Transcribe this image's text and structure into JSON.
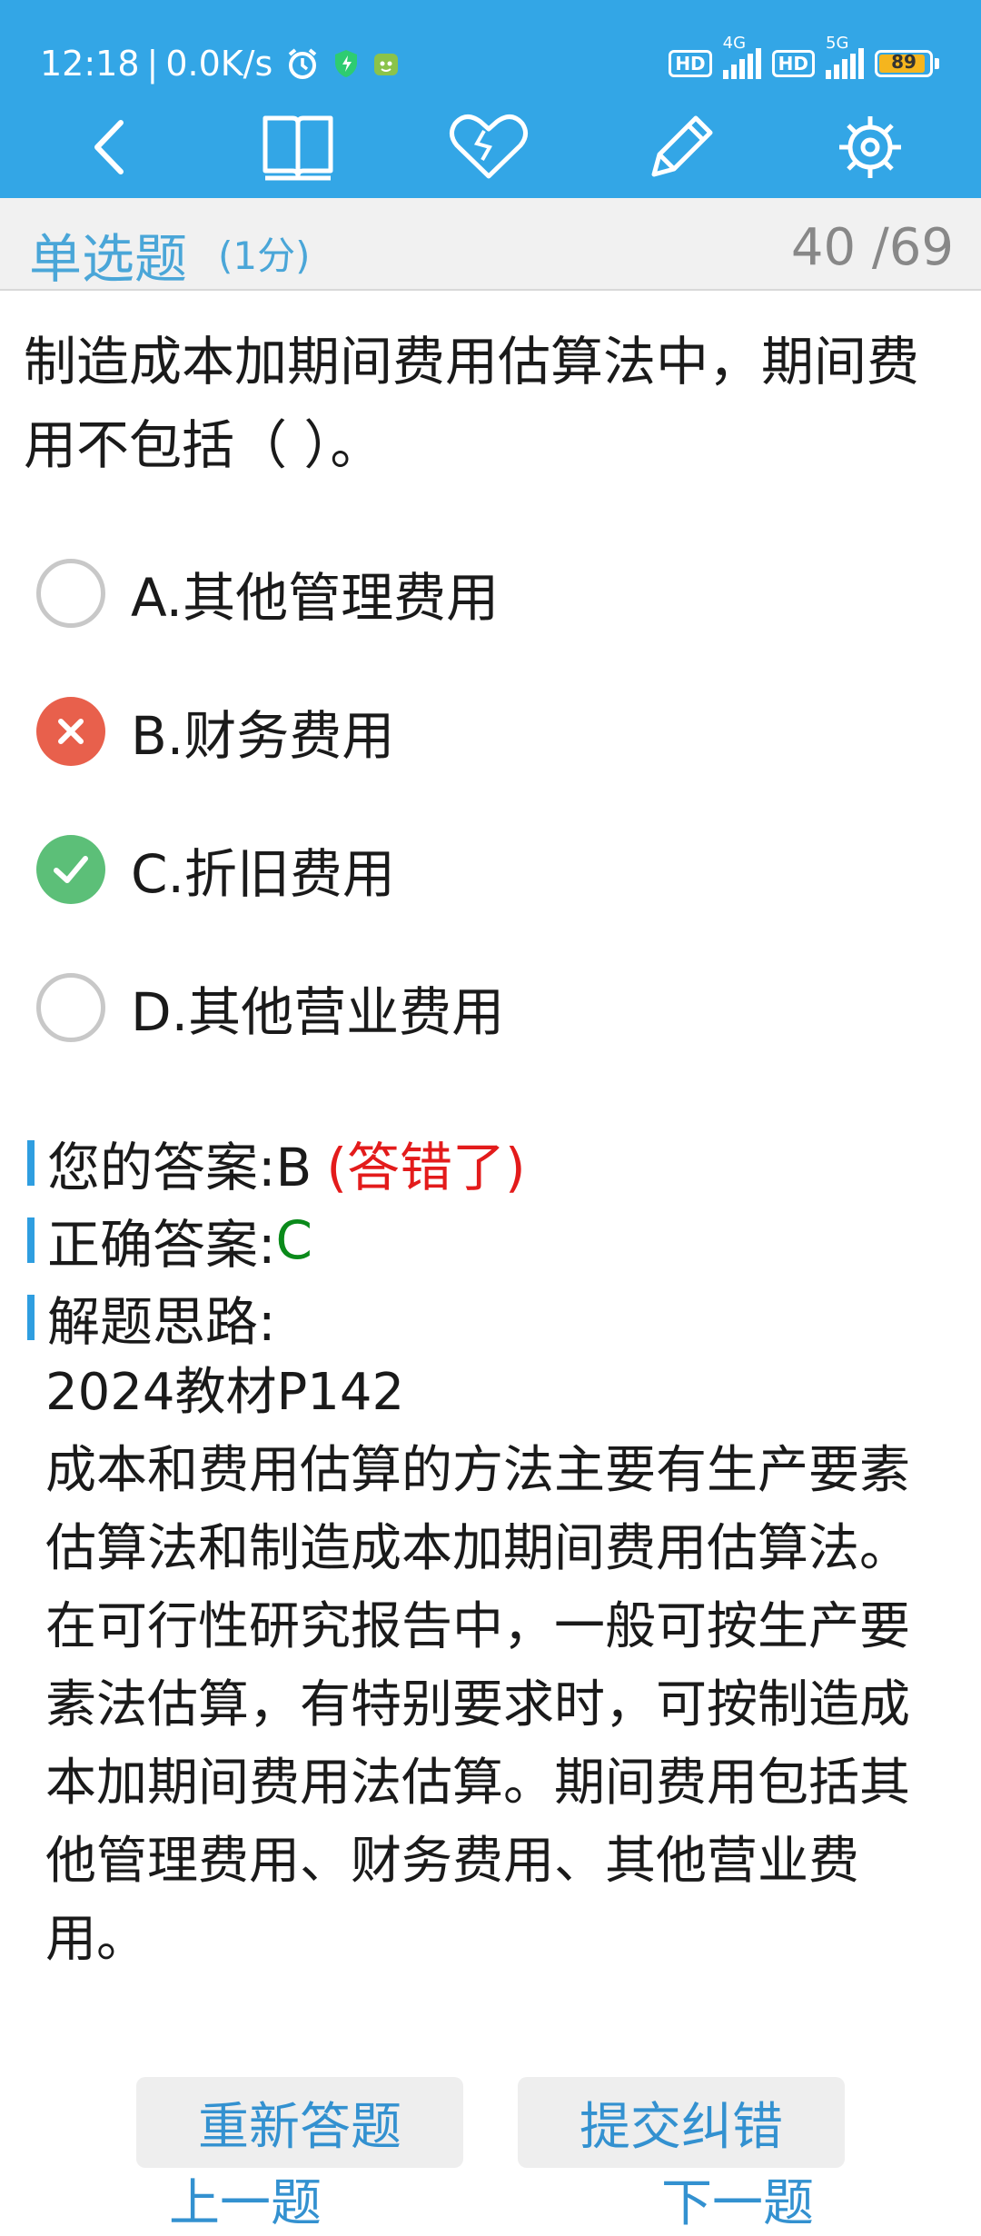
{
  "status": {
    "time": "12:18",
    "speed": "0.0K/s",
    "battery": "89",
    "net1": "4G",
    "net2": "5G",
    "hd": "HD"
  },
  "toolbar": {
    "icons": [
      "back-icon",
      "book-icon",
      "heart-icon",
      "pencil-icon",
      "settings-icon"
    ]
  },
  "question": {
    "type": "单选题",
    "score": "(1分)",
    "progress": "40 /69",
    "text": "制造成本加期间费用估算法中，期间费用不包括（ ）。",
    "options": [
      {
        "label": "A.其他管理费用",
        "state": "empty"
      },
      {
        "label": "B.财务费用",
        "state": "wrong"
      },
      {
        "label": "C.折旧费用",
        "state": "right"
      },
      {
        "label": "D.其他营业费用",
        "state": "empty"
      }
    ]
  },
  "result": {
    "your_answer_label": "您的答案:B",
    "your_answer_status": "(答错了)",
    "correct_label": "正确答案:",
    "correct_value": "C",
    "explain_label": "解题思路:",
    "explain_text": "2024教材P142\n成本和费用估算的方法主要有生产要素估算法和制造成本加期间费用估算法。在可行性研究报告中，一般可按生产要素法估算，有特别要求时，可按制造成本加期间费用法估算。期间费用包括其他管理费用、财务费用、其他营业费用。"
  },
  "actions": {
    "redo": "重新答题",
    "report": "提交纠错",
    "prev": "上一题",
    "next": "下一题"
  },
  "colors": {
    "primary": "#33a6e6",
    "wrong": "#e8604c",
    "right": "#5cbf78",
    "link": "#3391d0"
  }
}
